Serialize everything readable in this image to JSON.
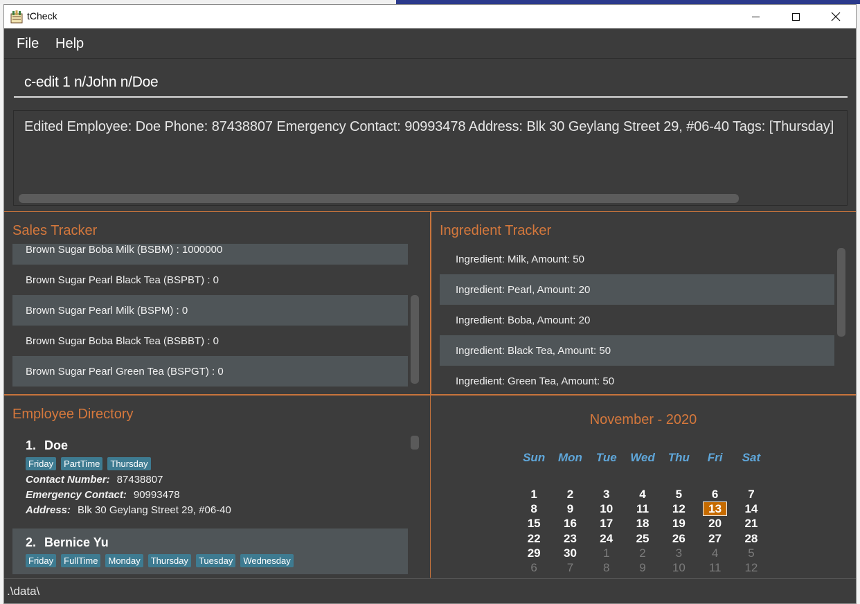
{
  "window": {
    "title": "tCheck",
    "controls": [
      "minimize-icon",
      "maximize-icon",
      "close-icon"
    ]
  },
  "menu": {
    "file": "File",
    "help": "Help"
  },
  "command": {
    "value": "c-edit 1 n/John n/Doe"
  },
  "result": {
    "text": "Edited Employee: Doe Phone: 87438807 Emergency Contact: 90993478 Address: Blk 30 Geylang Street 29, #06-40 Tags: [Thursday]"
  },
  "sales": {
    "title": "Sales Tracker",
    "items": [
      "Brown Sugar Boba Milk (BSBM) : 1000000",
      "Brown Sugar Pearl Black Tea (BSPBT) : 0",
      "Brown Sugar Pearl Milk (BSPM) : 0",
      "Brown Sugar Boba Black Tea (BSBBT) : 0",
      "Brown Sugar Pearl Green Tea (BSPGT) : 0"
    ]
  },
  "ingredients": {
    "title": "Ingredient Tracker",
    "items": [
      "Ingredient: Milk,  Amount: 50",
      "Ingredient: Pearl,  Amount: 20",
      "Ingredient: Boba,  Amount: 20",
      "Ingredient: Black Tea,  Amount: 50",
      "Ingredient: Green Tea,  Amount: 50"
    ]
  },
  "employees": {
    "title": "Employee Directory",
    "labels": {
      "contact": "Contact Number:",
      "emergency": "Emergency Contact:",
      "address": "Address:"
    },
    "list": [
      {
        "index": "1.",
        "name": "Doe",
        "tags": [
          "Friday",
          "PartTime",
          "Thursday"
        ],
        "contact": "87438807",
        "emergency": "90993478",
        "address": "Blk 30 Geylang Street 29, #06-40"
      },
      {
        "index": "2.",
        "name": "Bernice Yu",
        "tags": [
          "Friday",
          "FullTime",
          "Monday",
          "Thursday",
          "Tuesday",
          "Wednesday"
        ]
      }
    ]
  },
  "calendar": {
    "title": "November - 2020",
    "daynames": [
      "Sun",
      "Mon",
      "Tue",
      "Wed",
      "Thu",
      "Fri",
      "Sat"
    ],
    "weeks": [
      [
        "1",
        "2",
        "3",
        "4",
        "5",
        "6",
        "7"
      ],
      [
        "8",
        "9",
        "10",
        "11",
        "12",
        "13",
        "14"
      ],
      [
        "15",
        "16",
        "17",
        "18",
        "19",
        "20",
        "21"
      ],
      [
        "22",
        "23",
        "24",
        "25",
        "26",
        "27",
        "28"
      ],
      [
        "29",
        "30",
        "1",
        "2",
        "3",
        "4",
        "5"
      ],
      [
        "6",
        "7",
        "8",
        "9",
        "10",
        "11",
        "12"
      ]
    ],
    "today": "13",
    "accent": "#c66b00"
  },
  "status": {
    "path": ".\\data\\"
  },
  "colors": {
    "accent_orange": "#d5783c",
    "tag_blue": "#3e7b91",
    "dayname_blue": "#5fa6d9",
    "panel_bg": "#3c3c3c",
    "row_alt_bg": "#4f5558"
  }
}
